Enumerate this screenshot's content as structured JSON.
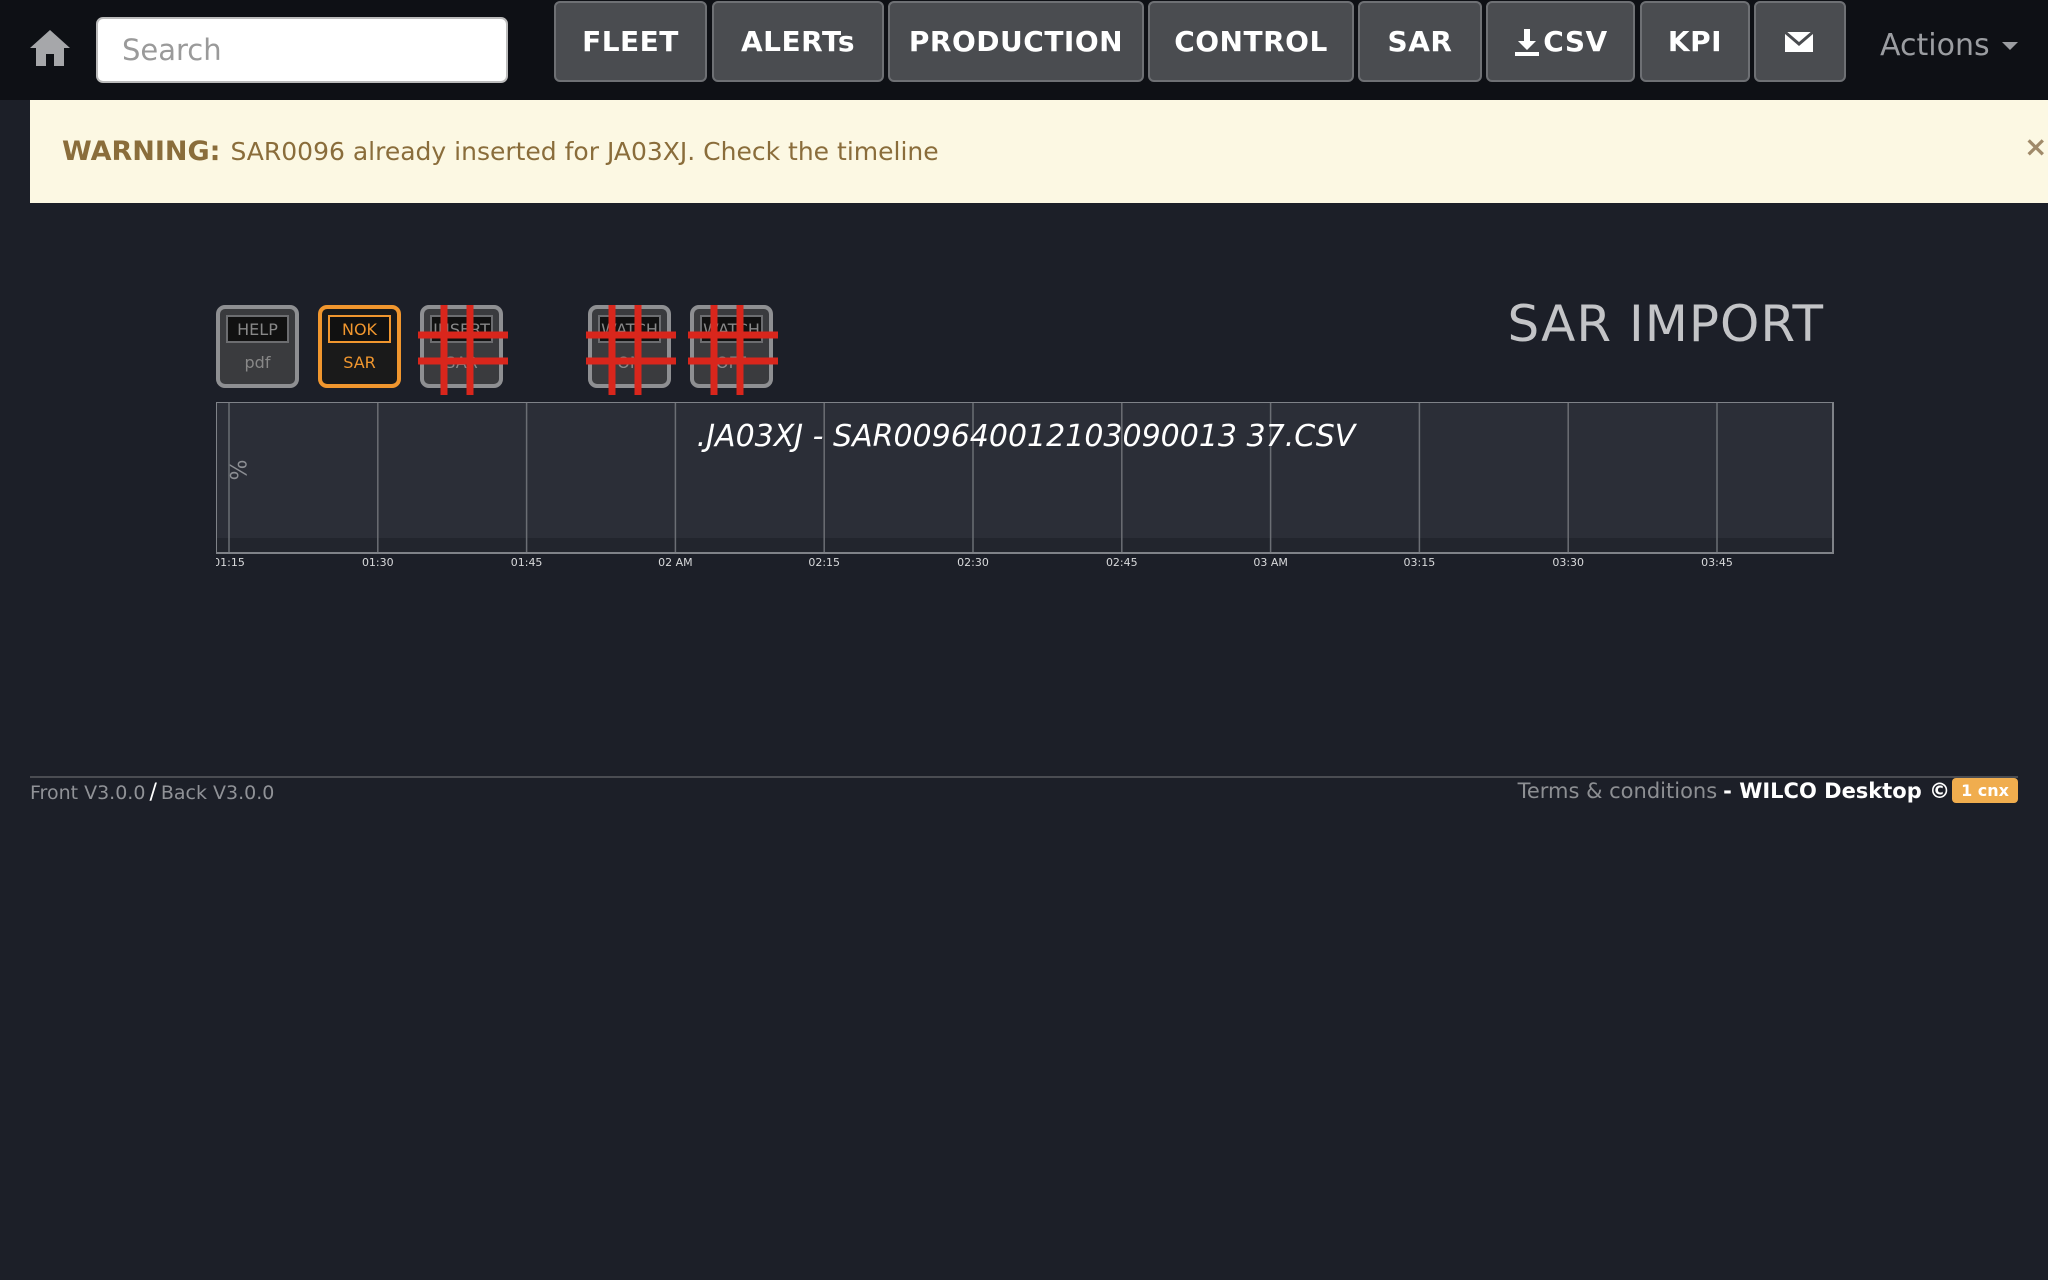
{
  "nav": {
    "home_icon": "home-icon",
    "search_placeholder": "Search",
    "buttons": [
      {
        "label": "FLEET"
      },
      {
        "label": "ALERTs"
      },
      {
        "label": "PRODUCTION"
      },
      {
        "label": "CONTROL"
      },
      {
        "label": "SAR"
      },
      {
        "label": "CSV",
        "icon": "download-icon"
      },
      {
        "label": "KPI"
      },
      {
        "label": "",
        "icon": "envelope-icon"
      }
    ],
    "actions_label": "Actions"
  },
  "warning": {
    "strong": "WARNING:",
    "message": "SAR0096 already inserted for JA03XJ. Check the timeline",
    "close": "×"
  },
  "tools": [
    {
      "top": "HELP",
      "bottom": "pdf",
      "style": "gray",
      "disabled": false
    },
    {
      "top": "NOK",
      "bottom": "SAR",
      "style": "orange",
      "disabled": false
    },
    {
      "top": "INSERT",
      "bottom": "SAR",
      "style": "gray",
      "disabled": true
    },
    {
      "top": "WATCH",
      "bottom": "ON",
      "style": "gray",
      "disabled": true
    },
    {
      "top": "WATCH",
      "bottom": "OFF",
      "style": "gray",
      "disabled": true
    }
  ],
  "title": "SAR IMPORT",
  "chart_data": {
    "type": "line",
    "title": ".JA03XJ - SAR009640012103090013 37.CSV",
    "ylabel": "%",
    "x_ticks": [
      "01:15",
      "01:30",
      "01:45",
      "02 AM",
      "02:15",
      "02:30",
      "02:45",
      "03 AM",
      "03:15",
      "03:30",
      "03:45"
    ],
    "series": [],
    "grid": true
  },
  "footer": {
    "front": "Front V3.0.0",
    "separator": "/",
    "back": "Back V3.0.0",
    "terms": "Terms & conditions",
    "brand": "- WILCO Desktop ©",
    "cnx": "1 cnx"
  },
  "colors": {
    "background": "#1c1f28",
    "navbar": "#0e1015",
    "accent_orange": "#f0962e",
    "warning_bg": "#fcf8e3",
    "warning_text": "#8a6d3b",
    "disabled_cross": "#d9261c"
  }
}
